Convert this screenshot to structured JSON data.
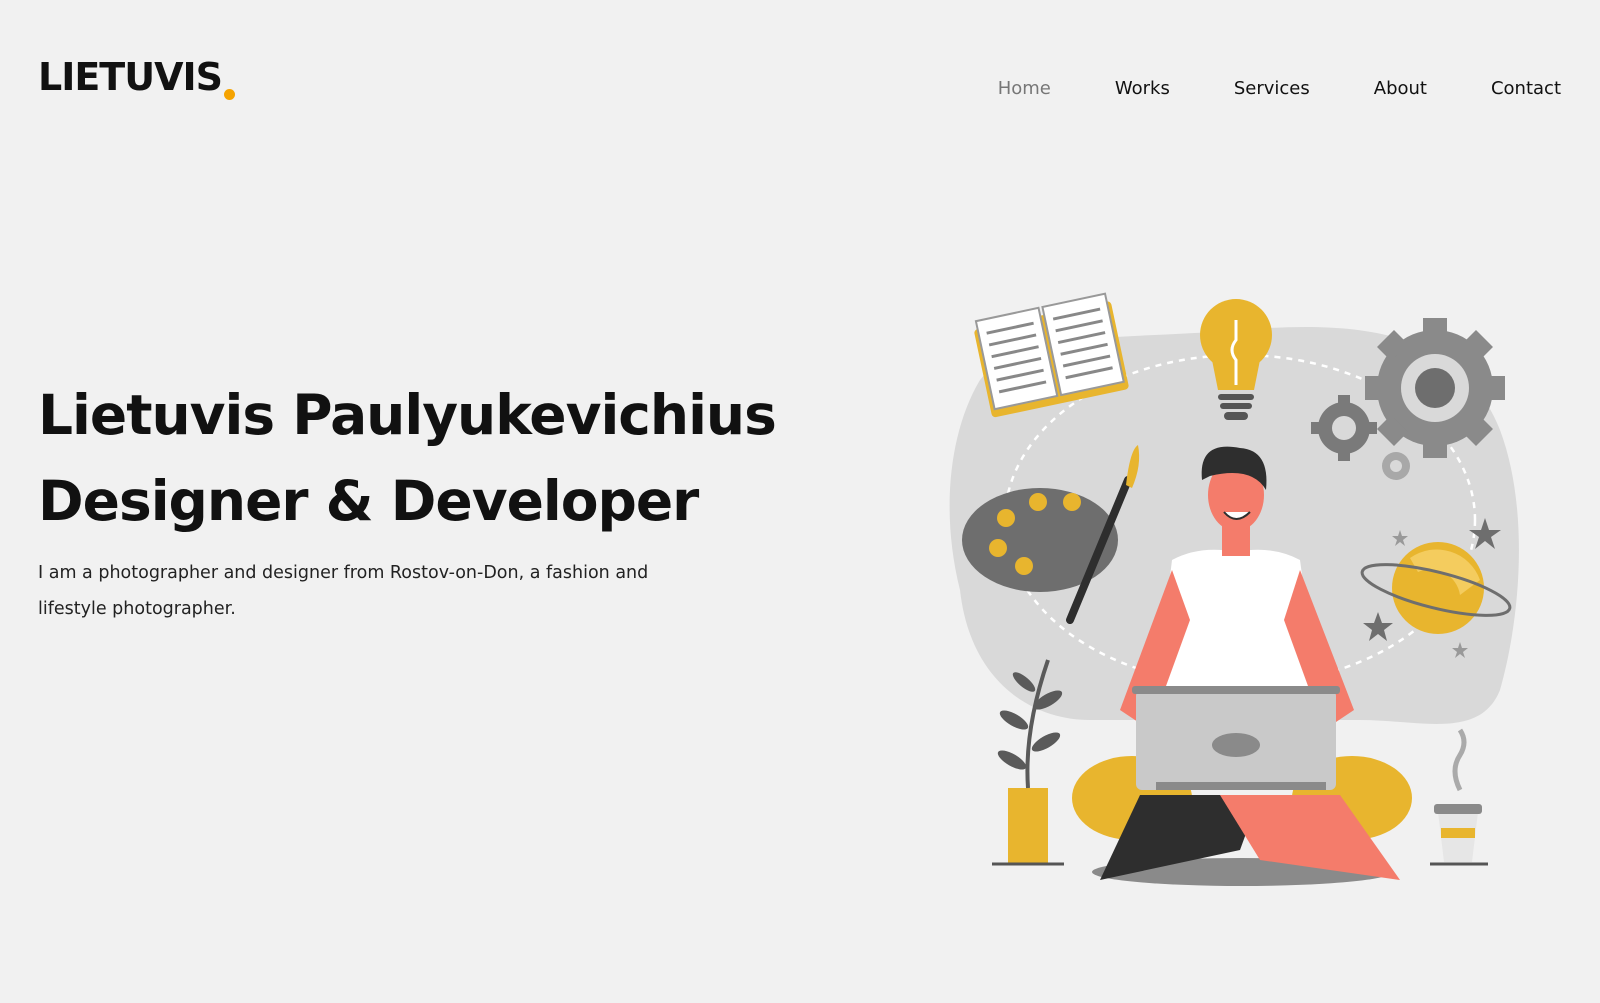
{
  "brand": {
    "logo_text": "LIETUVIS",
    "accent": "#f5a300"
  },
  "nav": {
    "items": [
      {
        "label": "Home",
        "active": true
      },
      {
        "label": "Works"
      },
      {
        "label": "Services"
      },
      {
        "label": "About"
      },
      {
        "label": "Contact"
      }
    ]
  },
  "hero": {
    "title_line1": "Lietuvis Paulyukevichius",
    "title_line2": "Designer & Developer",
    "description": "I am a photographer and designer from Rostov-on-Don, a fashion and lifestyle photographer."
  },
  "colors": {
    "background": "#f1f1f1",
    "accent_yellow": "#e8b52e",
    "skin": "#f47c6b",
    "gray": "#8a8a8a"
  }
}
